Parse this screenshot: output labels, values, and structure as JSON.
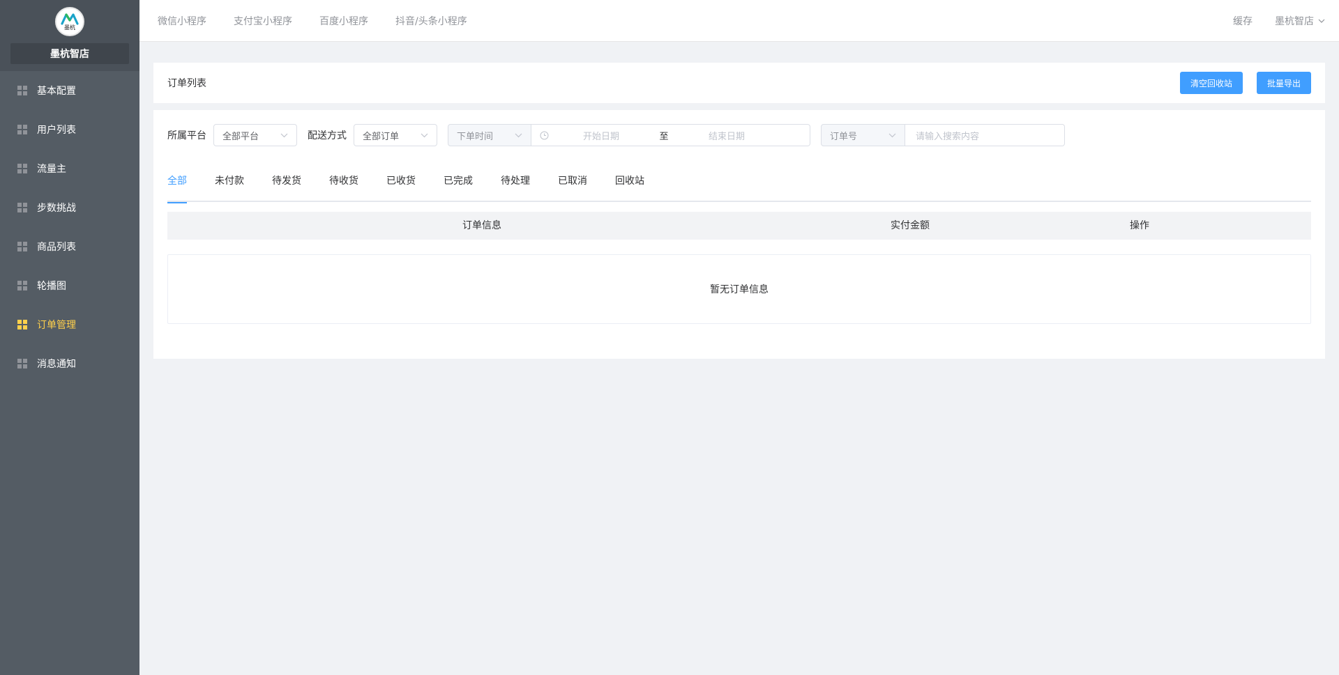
{
  "sidebar": {
    "logo_text": "墨杭",
    "store_name": "墨杭智店",
    "items": [
      {
        "label": "基本配置"
      },
      {
        "label": "用户列表"
      },
      {
        "label": "流量主"
      },
      {
        "label": "步数挑战"
      },
      {
        "label": "商品列表"
      },
      {
        "label": "轮播图"
      },
      {
        "label": "订单管理",
        "active": true
      },
      {
        "label": "消息通知"
      }
    ],
    "icon": "grid-icon",
    "active_color": "#ffd04b"
  },
  "header": {
    "nav": [
      {
        "label": "微信小程序"
      },
      {
        "label": "支付宝小程序"
      },
      {
        "label": "百度小程序"
      },
      {
        "label": "抖音/头条小程序"
      }
    ],
    "cache_label": "缓存",
    "user_label": "墨杭智店"
  },
  "page": {
    "title": "订单列表",
    "buttons": {
      "clear_recycle": "清空回收站",
      "batch_export": "批量导出"
    },
    "accent_color": "#409eff"
  },
  "filters": {
    "platform_label": "所属平台",
    "platform_value": "全部平台",
    "delivery_label": "配送方式",
    "delivery_value": "全部订单",
    "time_type_value": "下单时间",
    "start_placeholder": "开始日期",
    "range_separator": "至",
    "end_placeholder": "结束日期",
    "search_field_value": "订单号",
    "search_placeholder": "请输入搜索内容"
  },
  "tabs": [
    {
      "label": "全部",
      "active": true
    },
    {
      "label": "未付款"
    },
    {
      "label": "待发货"
    },
    {
      "label": "待收货"
    },
    {
      "label": "已收货"
    },
    {
      "label": "已完成"
    },
    {
      "label": "待处理"
    },
    {
      "label": "已取消"
    },
    {
      "label": "回收站"
    }
  ],
  "table": {
    "columns": [
      "订单信息",
      "实付金额",
      "操作"
    ],
    "empty_text": "暂无订单信息"
  }
}
